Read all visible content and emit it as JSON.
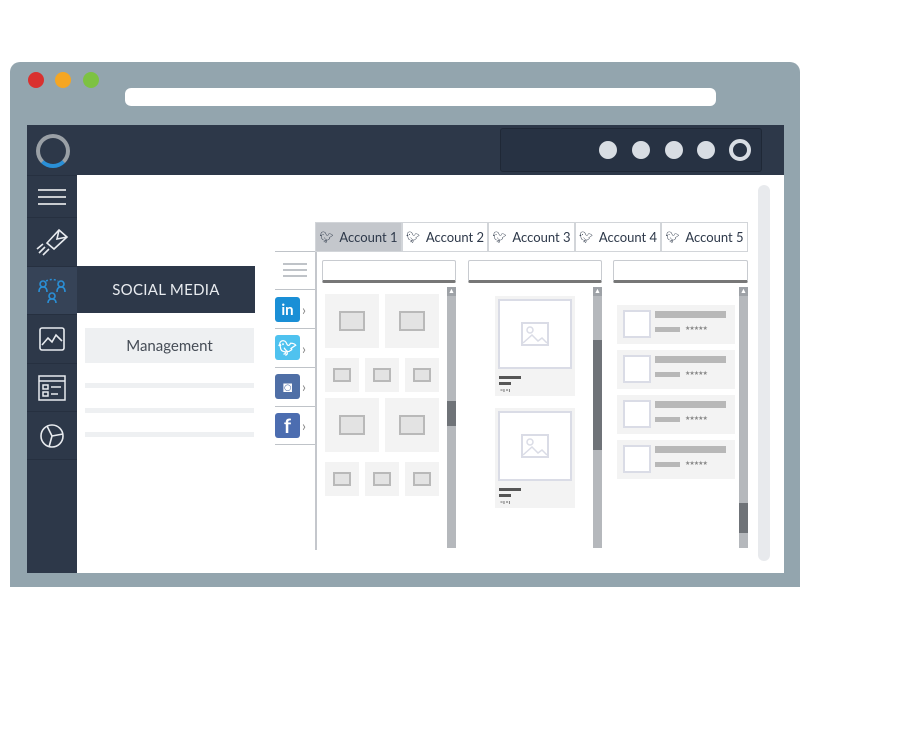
{
  "window": {
    "controls": [
      "close",
      "minimize",
      "maximize"
    ],
    "colors": {
      "close": "#d9312f",
      "minimize": "#f5a623",
      "maximize": "#7dc242",
      "frame": "#93a5ae",
      "dark": "#2d3849"
    }
  },
  "sidebar": {
    "items": [
      {
        "icon": "menu-icon"
      },
      {
        "icon": "rocket-mail-icon"
      },
      {
        "icon": "social-network-icon",
        "active": true
      },
      {
        "icon": "chart-icon"
      },
      {
        "icon": "list-icon"
      },
      {
        "icon": "pie-chart-icon"
      }
    ]
  },
  "menu": {
    "section": "SOCIAL MEDIA",
    "subitem": "Management"
  },
  "networks": [
    {
      "name": "linkedin",
      "glyph": "in",
      "color": "#1a8fd6"
    },
    {
      "name": "twitter",
      "glyph": "t",
      "color": "#4fc2ef"
    },
    {
      "name": "instagram",
      "glyph": "◙",
      "color": "#4f6fa6"
    },
    {
      "name": "facebook",
      "glyph": "f",
      "color": "#4c6db0"
    }
  ],
  "tabs": [
    {
      "label": "Account 1",
      "active": true
    },
    {
      "label": "Account 2"
    },
    {
      "label": "Account 3"
    },
    {
      "label": "Account 4"
    },
    {
      "label": "Account 5"
    }
  ],
  "rating": "★★★★★"
}
